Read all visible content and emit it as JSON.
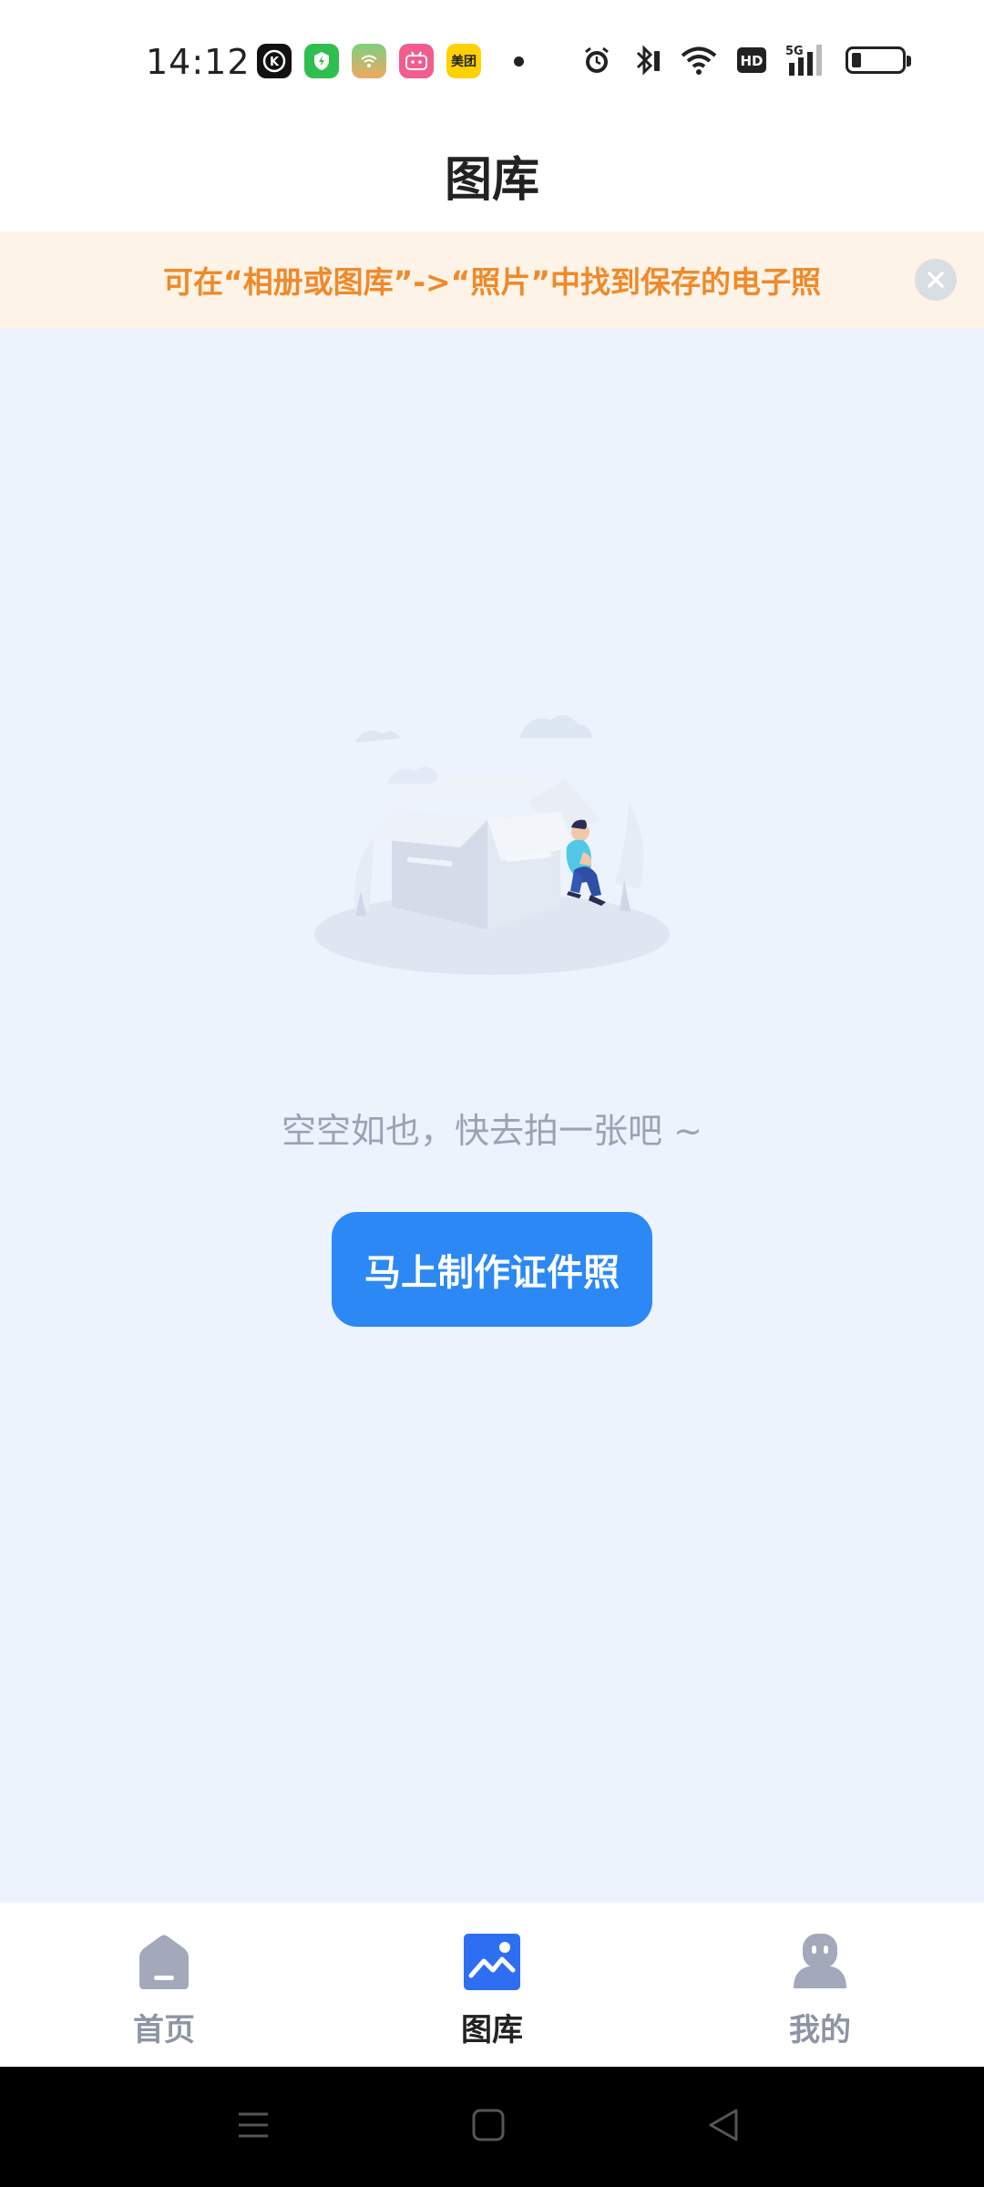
{
  "status_bar": {
    "time": "14:12",
    "app_icons": [
      {
        "name": "kk-app-icon",
        "color": "#111111",
        "glyph": "K"
      },
      {
        "name": "shield-app-icon",
        "color": "#2fbf4e",
        "glyph": "⚡"
      },
      {
        "name": "wifi-app-icon",
        "color": "#6fcf6f",
        "glyph": "◠"
      },
      {
        "name": "bilibili-app-icon",
        "color": "#f25d8e",
        "glyph": "bili"
      },
      {
        "name": "meituan-app-icon",
        "color": "#ffd100",
        "glyph": "美团"
      }
    ],
    "network": "5G",
    "hd_label": "HD"
  },
  "header": {
    "title": "图库"
  },
  "notice": {
    "text": "可在“相册或图库”->“照片”中找到保存的电子照"
  },
  "main": {
    "empty_text": "空空如也，快去拍一张吧 ~",
    "cta_label": "马上制作证件照"
  },
  "bottom_nav": {
    "items": [
      {
        "label": "首页",
        "icon": "home-icon",
        "active": false
      },
      {
        "label": "图库",
        "icon": "gallery-icon",
        "active": true
      },
      {
        "label": "我的",
        "icon": "profile-icon",
        "active": false
      }
    ]
  },
  "colors": {
    "accent": "#2b88f5",
    "notice_text": "#f0892a",
    "notice_bg": "#fdf3e6",
    "main_bg": "#edf3fc"
  }
}
